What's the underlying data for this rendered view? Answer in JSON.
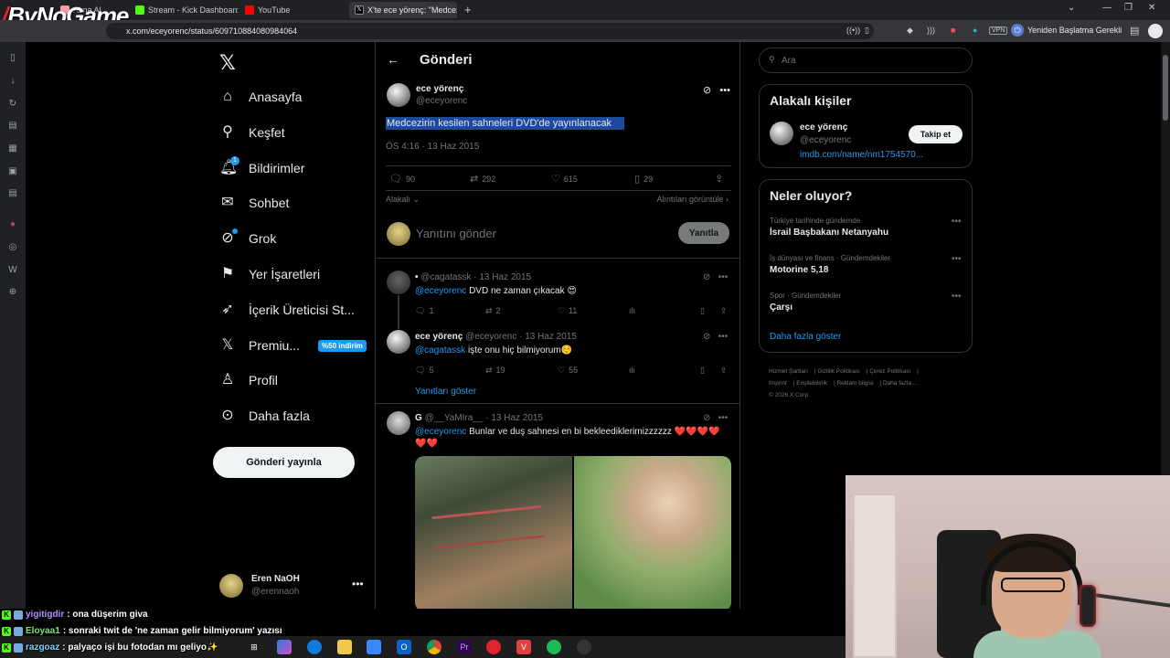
{
  "browser": {
    "tabs": [
      {
        "label": "Alma Al..."
      },
      {
        "label": "Stream - Kick Dashboard"
      },
      {
        "label": "YouTube"
      },
      {
        "label": "X'te ece yörenç: \"Medcezirin"
      }
    ],
    "url": "x.com/eceyorenc/status/609710884080984064",
    "restart_label": "Yeniden Başlatma Gerekli",
    "vpn_label": "VPN",
    "overlay_logo": "ByNoGame"
  },
  "nav": {
    "items": [
      {
        "label": "Anasayfa",
        "icon": "home-icon"
      },
      {
        "label": "Keşfet",
        "icon": "search-icon"
      },
      {
        "label": "Bildirimler",
        "icon": "bell-icon",
        "badge": "1"
      },
      {
        "label": "Sohbet",
        "icon": "mail-icon"
      },
      {
        "label": "Grok",
        "icon": "grok-icon"
      },
      {
        "label": "Yer İşaretleri",
        "icon": "bookmark-icon"
      },
      {
        "label": "İçerik Üreticisi St...",
        "icon": "rocket-icon"
      },
      {
        "label": "Premiu...",
        "icon": "x-premium-icon",
        "promo": "%50 indirim"
      },
      {
        "label": "Profil",
        "icon": "person-icon"
      },
      {
        "label": "Daha fazla",
        "icon": "more-icon"
      }
    ],
    "post_button": "Gönderi yayınla",
    "account": {
      "name": "Eren NaOH",
      "handle": "@erennaoh"
    }
  },
  "main": {
    "title": "Gönderi",
    "tweet": {
      "name": "ece yörenç",
      "handle": "@eceyorenc",
      "text": "Medcezirin kesilen sahneleri DVD'de yayınlanacak",
      "meta": "ÖS 4:16 · 13 Haz 2015",
      "replies": "90",
      "retweets": "292",
      "likes": "615",
      "bookmarks": "29",
      "related_label": "Alakalı",
      "quotes_label": "Alıntıları görüntüle"
    },
    "reply_box": {
      "placeholder": "Yanıtını gönder",
      "button": "Yanıtla"
    },
    "replies": [
      {
        "name": "•",
        "handle": "@cagatassk · 13 Haz 2015",
        "mention": "@eceyorenc",
        "text": " DVD ne zaman çıkacak 😍",
        "reply_count": "1",
        "rt_count": "2",
        "like_count": "11"
      },
      {
        "name": "ece yörenç",
        "handle": "@eceyorenc · 13 Haz 2015",
        "mention": "@cagatassk",
        "text": " işte onu hiç bilmiyorum☺️",
        "reply_count": "5",
        "rt_count": "19",
        "like_count": "55"
      },
      {
        "name": "G",
        "handle": "@__YaMIra__ · 13 Haz 2015",
        "mention": "@eceyorenc",
        "text": " Bunlar ve duş sahnesi en bi bekleediklerimizzzzzz ❤️❤️❤️❤️",
        "text2": "❤️❤️"
      }
    ],
    "show_replies": "Yanıtları göster"
  },
  "right": {
    "search_placeholder": "Ara",
    "related_people": {
      "title": "Alakalı kişiler",
      "name": "ece yörenç",
      "handle": "@eceyorenc",
      "link": "imdb.com/name/nm1754570...",
      "follow": "Takip et"
    },
    "trends": {
      "title": "Neler oluyor?",
      "items": [
        {
          "context": "Türkiye tarihinde gündemde",
          "topic": "İsrail Başbakanı Netanyahu"
        },
        {
          "context": "İş dünyası ve finans · Gündemdekiler",
          "topic": "Motorine 5,18"
        },
        {
          "context": "Spor · Gündemdekiler",
          "topic": "Çarşı"
        }
      ],
      "show_more": "Daha fazla göster"
    },
    "footer": [
      "Hizmet Şartları",
      "Gizlilik Politikası",
      "Çerez Politikası",
      "Imprint",
      "Erişilebilirlik",
      "Reklam bilgisi",
      "Daha fazla ...",
      "© 2026 X Corp."
    ]
  },
  "chat": [
    {
      "user": "yigitigdir",
      "text": ": ona düşerim giva"
    },
    {
      "user": "Eloyaa1",
      "text": ": sonraki twit de 'ne zaman gelir bilmiyorum' yazısı"
    },
    {
      "user": "razgoaz",
      "text": ": palyaço işi bu fotodan mı geliyo✨"
    }
  ]
}
